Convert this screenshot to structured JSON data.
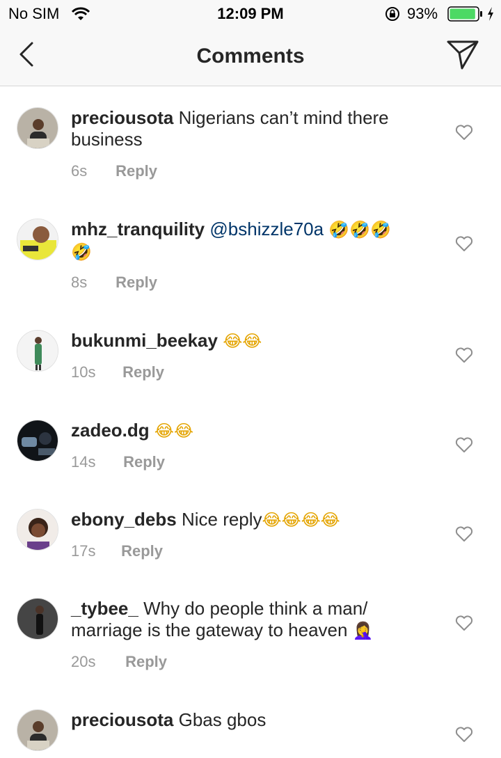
{
  "status_bar": {
    "carrier": "No SIM",
    "time": "12:09 PM",
    "battery_percent": "93%",
    "battery_level": 0.93,
    "battery_color": "#4cd964"
  },
  "nav": {
    "title": "Comments",
    "back_icon": "chevron-left-icon",
    "send_icon": "paper-plane-icon"
  },
  "reply_label": "Reply",
  "comments": [
    {
      "username": "preciousota",
      "text": "Nigerians can’t mind there business",
      "age": "6s"
    },
    {
      "username": "mhz_tranquility",
      "mention": "@bshizzle70a",
      "emoji": "🤣🤣🤣",
      "emoji2": "🤣",
      "age": "8s"
    },
    {
      "username": "bukunmi_beekay",
      "emoji": "😂😂",
      "age": "10s"
    },
    {
      "username": "zadeo.dg",
      "emoji": "😂😂",
      "age": "14s"
    },
    {
      "username": "ebony_debs",
      "text": "Nice reply",
      "emoji": "😂😂😂😂",
      "age": "17s"
    },
    {
      "username": "_tybee_",
      "text": "Why do people think a man/ marriage is the gateway to heaven",
      "emoji": "🤦‍♀️",
      "age": "20s"
    },
    {
      "username": "preciousota",
      "text": "Gbas gbos"
    }
  ]
}
